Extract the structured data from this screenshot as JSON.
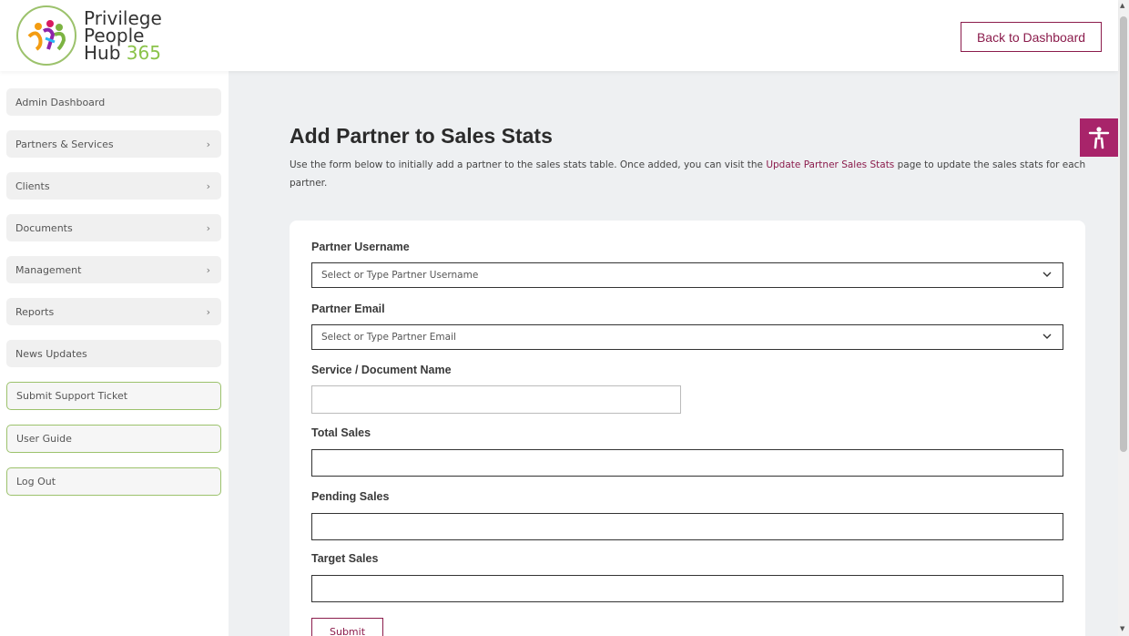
{
  "brand": {
    "line1": "Privilege",
    "line2": "People",
    "line3": "Hub",
    "number": "365"
  },
  "header": {
    "back_label": "Back to Dashboard"
  },
  "sidebar": {
    "items": [
      {
        "label": "Admin Dashboard",
        "chevron": ""
      },
      {
        "label": "Partners & Services",
        "chevron": "›"
      },
      {
        "label": "Clients",
        "chevron": "›"
      },
      {
        "label": "Documents",
        "chevron": "›"
      },
      {
        "label": "Management",
        "chevron": "›"
      },
      {
        "label": "Reports",
        "chevron": "›"
      },
      {
        "label": "News Updates",
        "chevron": ""
      }
    ],
    "links": [
      {
        "label": "Submit Support Ticket"
      },
      {
        "label": "User Guide"
      },
      {
        "label": "Log Out"
      }
    ]
  },
  "page": {
    "title": "Add Partner to Sales Stats",
    "desc_before": "Use the form below to initially add a partner to the sales stats table. Once added, you can visit the ",
    "desc_link": "Update Partner Sales Stats",
    "desc_after": " page to update the sales stats for each partner."
  },
  "form": {
    "partner_username": {
      "label": "Partner Username",
      "placeholder": "Select or Type Partner Username"
    },
    "partner_email": {
      "label": "Partner Email",
      "placeholder": "Select or Type Partner Email"
    },
    "service_name": {
      "label": "Service / Document Name",
      "value": ""
    },
    "total_sales": {
      "label": "Total Sales",
      "value": ""
    },
    "pending_sales": {
      "label": "Pending Sales",
      "value": ""
    },
    "target_sales": {
      "label": "Target Sales",
      "value": ""
    },
    "submit_label": "Submit"
  },
  "colors": {
    "accent": "#8b1c4c",
    "brand_green": "#8bc34a",
    "accessibility": "#a8246a"
  },
  "icons": {
    "accessibility": "accessibility-icon",
    "dropdown": "chevron-down-icon",
    "nav": "chevron-right-icon"
  }
}
